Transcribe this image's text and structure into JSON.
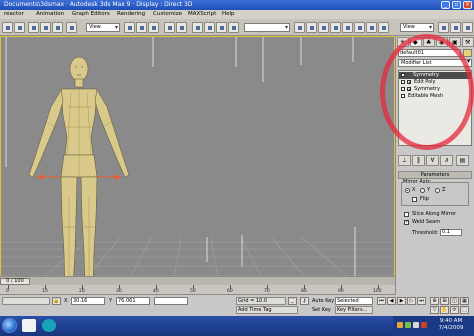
{
  "window": {
    "title": "Documents\\3dsmax    ·    Autodesk 3ds Max 9    ·    Display : Direct 3D"
  },
  "menu": [
    "reactor",
    "Animation",
    "Graph Editors",
    "Rendering",
    "Customize",
    "MAXScript",
    "Help"
  ],
  "toolbar": {
    "view_dropdown": "View",
    "view_dropdown_right": "View"
  },
  "command_panel": {
    "object_name": "default01",
    "object_color": "#e6d27a",
    "modifier_list": "Modifier List",
    "stack": [
      {
        "label": "Symmetry",
        "selected": true,
        "expandable": false
      },
      {
        "label": "Edit Poly",
        "selected": false,
        "expandable": true
      },
      {
        "label": "Symmetry",
        "selected": false,
        "expandable": true
      },
      {
        "label": "Editable Mesh",
        "selected": false,
        "expandable": false
      }
    ],
    "rollout_title": "Parameters",
    "mirror_axis_label": "Mirror Axis:",
    "axes": [
      "X",
      "Y",
      "Z"
    ],
    "selected_axis": "X",
    "flip_label": "Flip",
    "slice_label": "Slice Along Mirror",
    "weld_label": "Weld Seam",
    "threshold_label": "Threshold:",
    "threshold_value": "0.1"
  },
  "timeline": {
    "slider_label": "0 / 100",
    "ticks": [
      "0",
      "10",
      "20",
      "30",
      "40",
      "50",
      "60",
      "70",
      "80",
      "90",
      "100"
    ]
  },
  "status": {
    "x_label": "X",
    "x_value": "30.16",
    "y_label": "Y",
    "y_value": "76.061",
    "grid": "Grid = 10.0",
    "add_time_tag": "Add Time Tag",
    "auto_key": "Auto Key",
    "set_key": "Set Key",
    "selected": "Selected",
    "key_filters": "Key Filters..."
  },
  "taskbar": {
    "time": "9:40 AM",
    "date": "7/4/2009"
  },
  "annotation_color": "#e6283c"
}
